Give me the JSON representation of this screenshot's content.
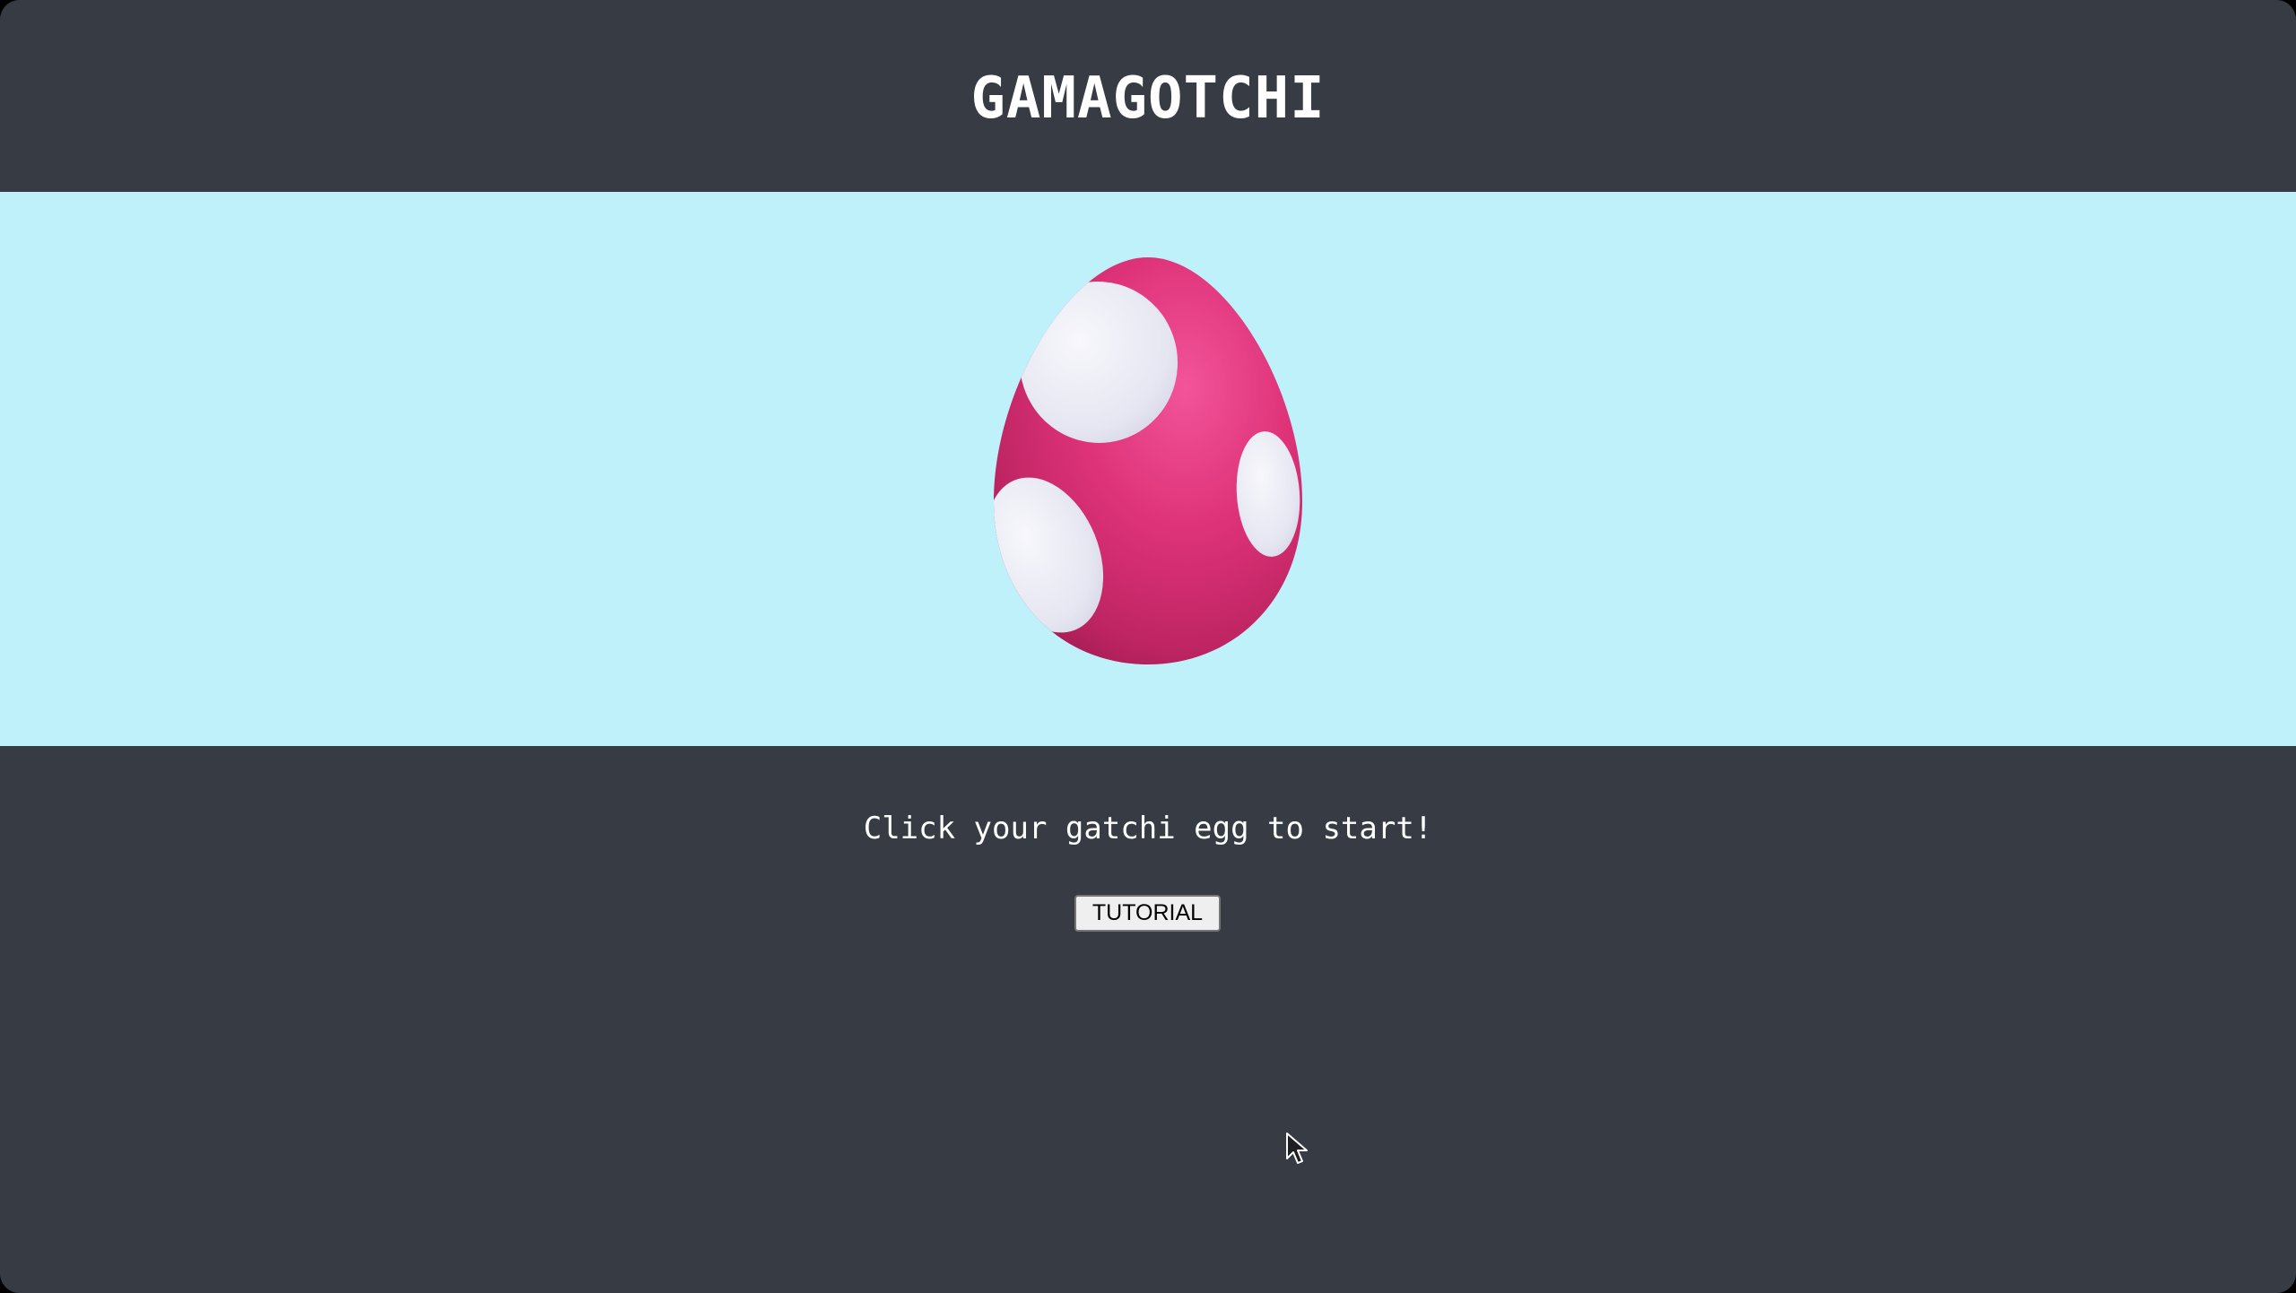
{
  "app": {
    "title": "GAMAGOTCHI"
  },
  "stage": {
    "egg_icon": "pink-spotted-egg",
    "colors": {
      "background": "#bff1fa",
      "egg": "#e0357a",
      "spots": "#e8e8f4"
    }
  },
  "footer": {
    "instructions": "Click your gatchi egg to start!",
    "tutorial_label": "TUTORIAL"
  },
  "colors": {
    "frame": "#363b44",
    "text": "#ffffff"
  }
}
